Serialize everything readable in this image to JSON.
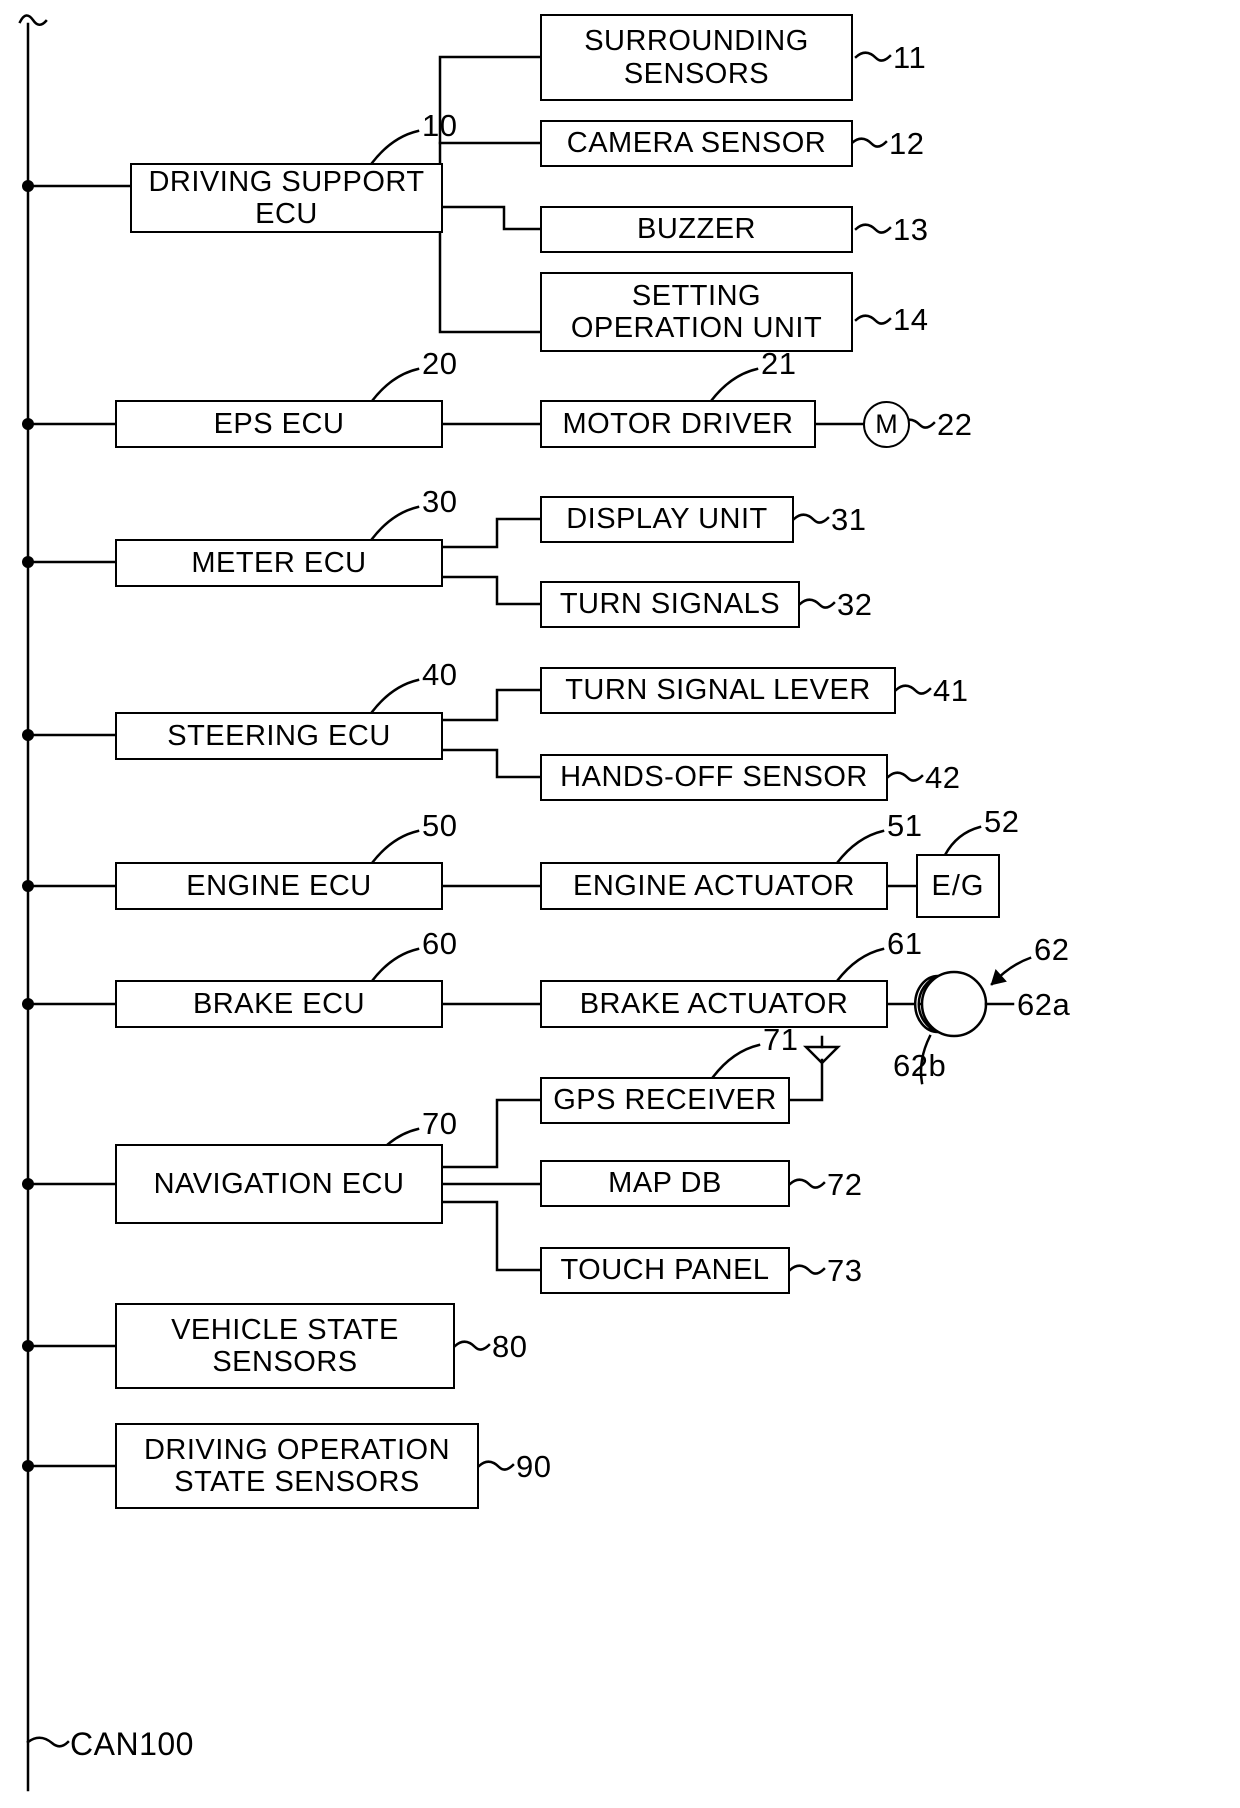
{
  "figure": {
    "type": "patent-block-diagram",
    "bus_label": "CAN100",
    "bus_name": "CAN"
  },
  "blocks": [
    {
      "id": "b10",
      "label": "DRIVING SUPPORT\nECU",
      "ref": "10"
    },
    {
      "id": "b11",
      "label": "SURROUNDING\nSENSORS",
      "ref": "11"
    },
    {
      "id": "b12",
      "label": "CAMERA SENSOR",
      "ref": "12"
    },
    {
      "id": "b13",
      "label": "BUZZER",
      "ref": "13"
    },
    {
      "id": "b14",
      "label": "SETTING\nOPERATION UNIT",
      "ref": "14"
    },
    {
      "id": "b20",
      "label": "EPS ECU",
      "ref": "20"
    },
    {
      "id": "b21",
      "label": "MOTOR DRIVER",
      "ref": "21"
    },
    {
      "id": "b22",
      "label": "M",
      "ref": "22"
    },
    {
      "id": "b30",
      "label": "METER ECU",
      "ref": "30"
    },
    {
      "id": "b31",
      "label": "DISPLAY UNIT",
      "ref": "31"
    },
    {
      "id": "b32",
      "label": "TURN SIGNALS",
      "ref": "32"
    },
    {
      "id": "b40",
      "label": "STEERING ECU",
      "ref": "40"
    },
    {
      "id": "b41",
      "label": "TURN SIGNAL LEVER",
      "ref": "41"
    },
    {
      "id": "b42",
      "label": "HANDS-OFF SENSOR",
      "ref": "42"
    },
    {
      "id": "b50",
      "label": "ENGINE ECU",
      "ref": "50"
    },
    {
      "id": "b51",
      "label": "ENGINE ACTUATOR",
      "ref": "51"
    },
    {
      "id": "b52",
      "label": "E/G",
      "ref": "52"
    },
    {
      "id": "b60",
      "label": "BRAKE ECU",
      "ref": "60"
    },
    {
      "id": "b61",
      "label": "BRAKE ACTUATOR",
      "ref": "61"
    },
    {
      "id": "b62",
      "label": "",
      "ref": "62"
    },
    {
      "id": "b62a",
      "label": "",
      "ref": "62a"
    },
    {
      "id": "b62b",
      "label": "",
      "ref": "62b"
    },
    {
      "id": "b70",
      "label": "NAVIGATION ECU",
      "ref": "70"
    },
    {
      "id": "b71",
      "label": "GPS RECEIVER",
      "ref": "71"
    },
    {
      "id": "b72",
      "label": "MAP DB",
      "ref": "72"
    },
    {
      "id": "b73",
      "label": "TOUCH PANEL",
      "ref": "73"
    },
    {
      "id": "b80",
      "label": "VEHICLE STATE\nSENSORS",
      "ref": "80"
    },
    {
      "id": "b90",
      "label": "DRIVING OPERATION\nSTATE SENSORS",
      "ref": "90"
    }
  ],
  "labels": {
    "driving_support_ecu": "DRIVING SUPPORT\nECU",
    "surrounding_sensors": "SURROUNDING\nSENSORS",
    "camera_sensor": "CAMERA SENSOR",
    "buzzer": "BUZZER",
    "setting_operation_unit": "SETTING\nOPERATION UNIT",
    "eps_ecu": "EPS ECU",
    "motor_driver": "MOTOR DRIVER",
    "motor": "M",
    "meter_ecu": "METER ECU",
    "display_unit": "DISPLAY UNIT",
    "turn_signals": "TURN SIGNALS",
    "steering_ecu": "STEERING ECU",
    "turn_signal_lever": "TURN SIGNAL LEVER",
    "hands_off_sensor": "HANDS-OFF SENSOR",
    "engine_ecu": "ENGINE ECU",
    "engine_actuator": "ENGINE ACTUATOR",
    "engine": "E/G",
    "brake_ecu": "BRAKE ECU",
    "brake_actuator": "BRAKE ACTUATOR",
    "navigation_ecu": "NAVIGATION ECU",
    "gps_receiver": "GPS RECEIVER",
    "map_db": "MAP DB",
    "touch_panel": "TOUCH PANEL",
    "vehicle_state_sensors": "VEHICLE STATE\nSENSORS",
    "driving_operation_state_sensors": "DRIVING OPERATION\nSTATE SENSORS",
    "can_bus": "CAN100"
  },
  "refs": {
    "r10": "10",
    "r11": "11",
    "r12": "12",
    "r13": "13",
    "r14": "14",
    "r20": "20",
    "r21": "21",
    "r22": "22",
    "r30": "30",
    "r31": "31",
    "r32": "32",
    "r40": "40",
    "r41": "41",
    "r42": "42",
    "r50": "50",
    "r51": "51",
    "r52": "52",
    "r60": "60",
    "r61": "61",
    "r62": "62",
    "r62a": "62a",
    "r62b": "62b",
    "r70": "70",
    "r71": "71",
    "r72": "72",
    "r73": "73",
    "r80": "80",
    "r90": "90"
  },
  "colors": {
    "line": "#000000",
    "background": "#ffffff",
    "text": "#000000"
  }
}
